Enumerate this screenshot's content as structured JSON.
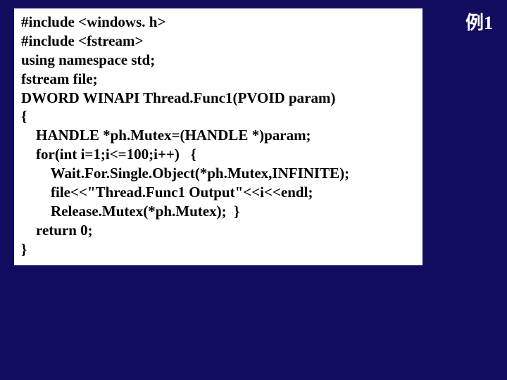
{
  "header": {
    "label": "例1"
  },
  "code": {
    "lines": [
      "#include <windows. h>",
      "#include <fstream>",
      "using namespace std;",
      "fstream file;",
      "DWORD WINAPI Thread.Func1(PVOID param)",
      "{",
      "    HANDLE *ph.Mutex=(HANDLE *)param;",
      "    for(int i=1;i<=100;i++)   {",
      "        Wait.For.Single.Object(*ph.Mutex,INFINITE);",
      "        file<<\"Thread.Func1 Output\"<<i<<endl;",
      "        Release.Mutex(*ph.Mutex);  }",
      "    return 0;",
      "}"
    ]
  }
}
